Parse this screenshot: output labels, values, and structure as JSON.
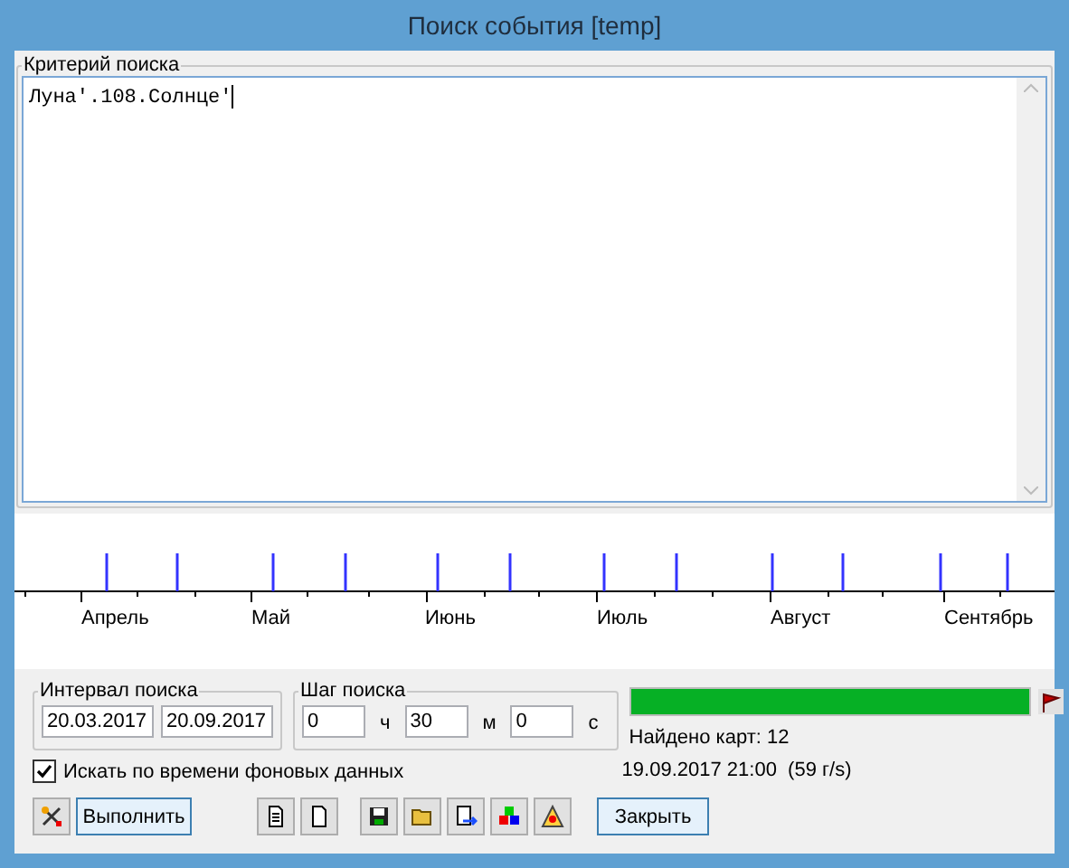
{
  "window": {
    "title": "Поиск события [temp]"
  },
  "criteria": {
    "label": "Критерий поиска",
    "value": "Луна'.108.Солнце'"
  },
  "timeline": {
    "months": [
      "Апрель",
      "Май",
      "Июнь",
      "Июль",
      "Август",
      "Сентябрь"
    ]
  },
  "interval": {
    "label": "Интервал поиска",
    "from": "20.03.2017",
    "to": "20.09.2017"
  },
  "step": {
    "label": "Шаг поиска",
    "fields": [
      {
        "value": "0",
        "unit": "ч"
      },
      {
        "value": "30",
        "unit": "м"
      },
      {
        "value": "0",
        "unit": "с"
      }
    ]
  },
  "background_time": {
    "label": "Искать по времени фоновых данных",
    "checked": true
  },
  "progress": {
    "level": 1.0
  },
  "found": "Найдено карт: 12",
  "current": "19.09.2017 21:00  (59 г/s)",
  "buttons": {
    "run": "Выполнить",
    "close": "Закрыть"
  }
}
